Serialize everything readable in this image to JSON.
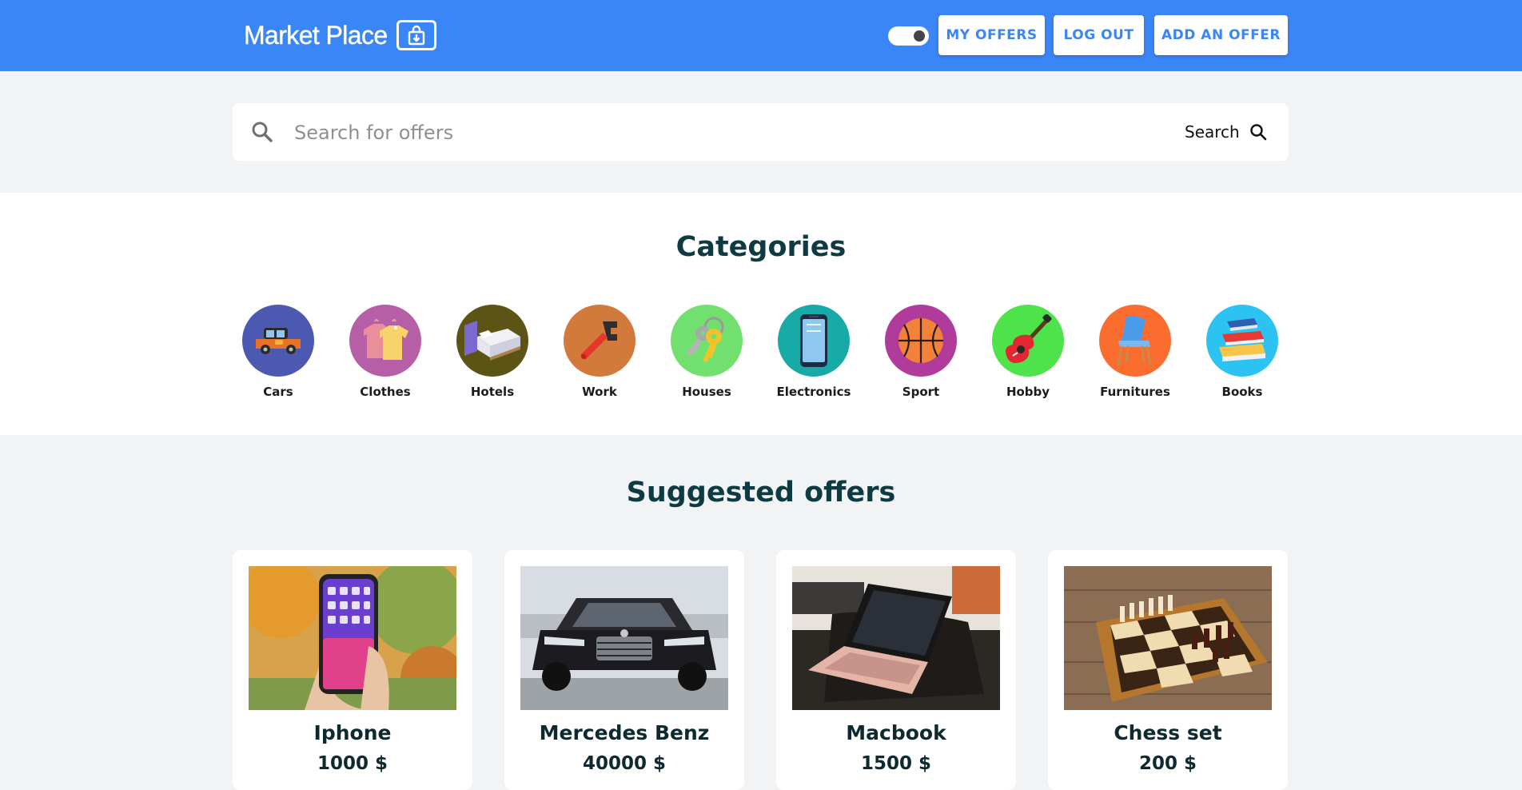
{
  "header": {
    "brand": "Market Place",
    "my_offers_label": "MY OFFERS",
    "logout_label": "LOG OUT",
    "add_offer_label": "ADD AN OFFER",
    "theme_toggle_on": true
  },
  "search": {
    "placeholder": "Search for offers",
    "value": "",
    "button_label": "Search"
  },
  "categories": {
    "title": "Categories",
    "items": [
      {
        "label": "Cars",
        "icon": "car-icon",
        "color": "#4c59b1"
      },
      {
        "label": "Clothes",
        "icon": "clothes-icon",
        "color": "#b65fa7"
      },
      {
        "label": "Hotels",
        "icon": "bed-icon",
        "color": "#5c5415"
      },
      {
        "label": "Work",
        "icon": "wrench-icon",
        "color": "#d27a3c"
      },
      {
        "label": "Houses",
        "icon": "keys-icon",
        "color": "#72e06f"
      },
      {
        "label": "Electronics",
        "icon": "smartphone-icon",
        "color": "#18aaa6"
      },
      {
        "label": "Sport",
        "icon": "basketball-icon",
        "color": "#b03b9a"
      },
      {
        "label": "Hobby",
        "icon": "guitar-icon",
        "color": "#4ee24b"
      },
      {
        "label": "Furnitures",
        "icon": "chair-icon",
        "color": "#fb6d2f"
      },
      {
        "label": "Books",
        "icon": "books-icon",
        "color": "#2cc3f2"
      }
    ]
  },
  "offers": {
    "title": "Suggested offers",
    "items": [
      {
        "title": "Iphone",
        "price": "1000 $",
        "image": "iphone-photo"
      },
      {
        "title": "Mercedes Benz",
        "price": "40000 $",
        "image": "mercedes-photo"
      },
      {
        "title": "Macbook",
        "price": "1500 $",
        "image": "macbook-photo"
      },
      {
        "title": "Chess set",
        "price": "200 $",
        "image": "chess-set-photo"
      }
    ]
  },
  "colors": {
    "brand_blue": "#3b86f7",
    "title_dark": "#0e3a42",
    "page_bg": "#f2f3f5"
  }
}
